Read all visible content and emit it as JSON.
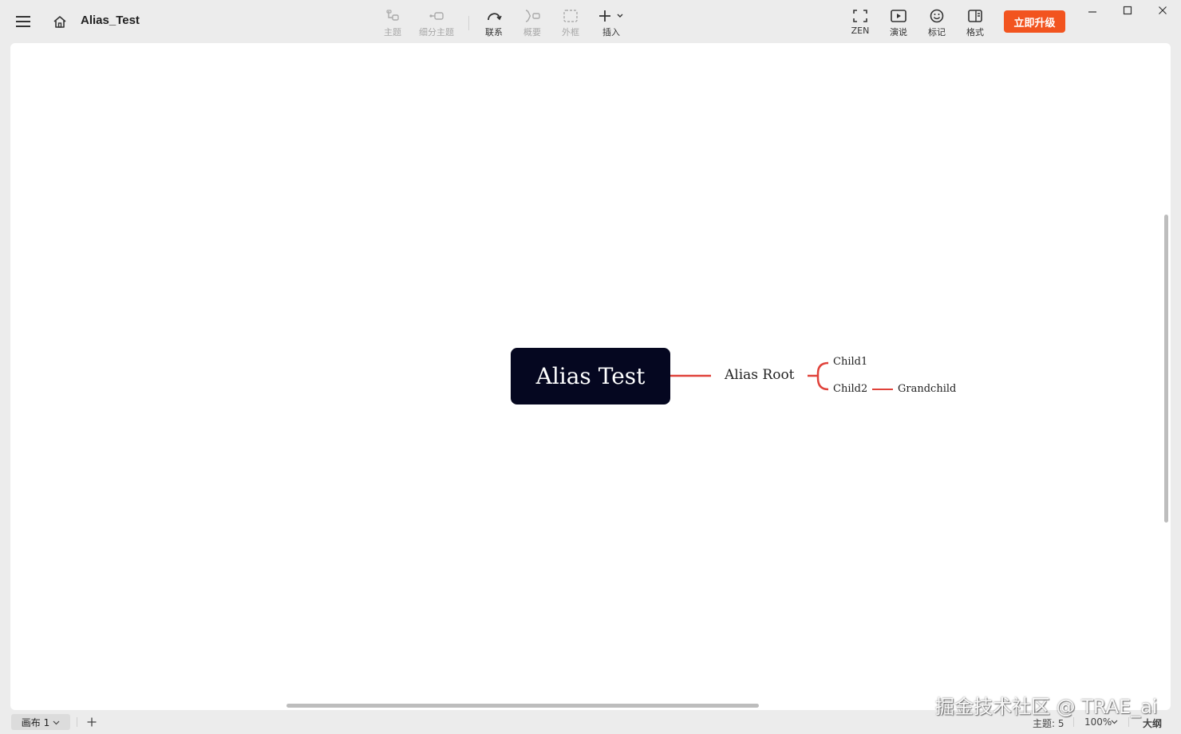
{
  "app": {
    "document_title": "Alias_Test"
  },
  "toolbar": {
    "topic_label": "主题",
    "subtopic_label": "细分主题",
    "relationship_label": "联系",
    "summary_label": "概要",
    "boundary_label": "外框",
    "insert_label": "插入",
    "zen_label": "ZEN",
    "pitch_label": "演说",
    "marker_label": "标记",
    "format_label": "格式",
    "upgrade_label": "立即升级"
  },
  "mindmap": {
    "central_topic": "Alias Test",
    "main_topic": "Alias Root",
    "subtopics": [
      "Child1",
      "Child2"
    ],
    "grandchild": "Grandchild",
    "branch_color": "#e0423a",
    "central_bg": "#050720"
  },
  "statusbar": {
    "sheet_label": "画布 1",
    "topic_count": "主题: 5",
    "zoom": "100%",
    "outline_label": "大纲"
  },
  "watermark": "掘金技术社区 @ TRAE_ai",
  "colors": {
    "accent": "#f2541f",
    "background": "#ececec",
    "canvas": "#ffffff"
  }
}
